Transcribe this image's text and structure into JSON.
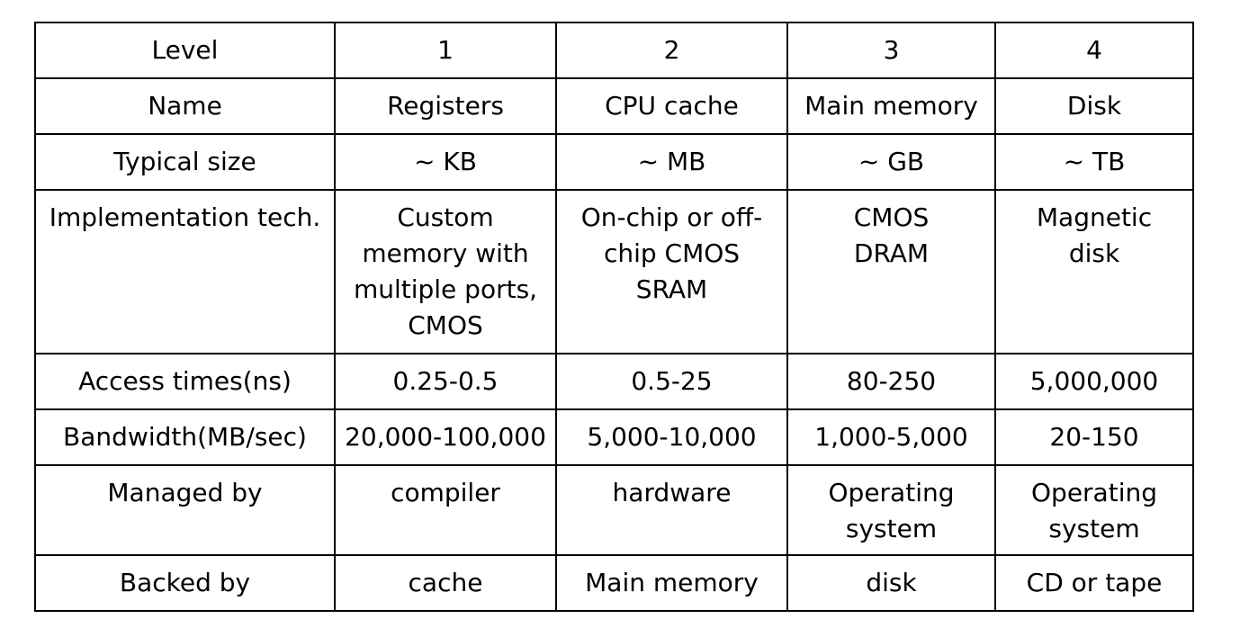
{
  "table": {
    "rows": [
      {
        "label": "Level",
        "cells": [
          "1",
          "2",
          "3",
          "4"
        ]
      },
      {
        "label": "Name",
        "cells": [
          "Registers",
          "CPU cache",
          "Main memory",
          "Disk"
        ]
      },
      {
        "label": "Typical size",
        "cells": [
          "~ KB",
          "~ MB",
          "~ GB",
          "~ TB"
        ]
      },
      {
        "label": "Implementation tech.",
        "cells": [
          "Custom\nmemory with\nmultiple ports,\nCMOS",
          "On-chip or off-\nchip CMOS\nSRAM",
          "CMOS\nDRAM",
          "Magnetic\ndisk"
        ]
      },
      {
        "label": "Access times(ns)",
        "cells": [
          "0.25-0.5",
          "0.5-25",
          "80-250",
          "5,000,000"
        ]
      },
      {
        "label": "Bandwidth(MB/sec)",
        "cells": [
          "20,000-100,000",
          "5,000-10,000",
          "1,000-5,000",
          "20-150"
        ]
      },
      {
        "label": "Managed by",
        "cells": [
          "compiler",
          "hardware",
          "Operating\nsystem",
          "Operating\nsystem"
        ]
      },
      {
        "label": "Backed by",
        "cells": [
          "cache",
          "Main memory",
          "disk",
          "CD or tape"
        ]
      }
    ]
  }
}
